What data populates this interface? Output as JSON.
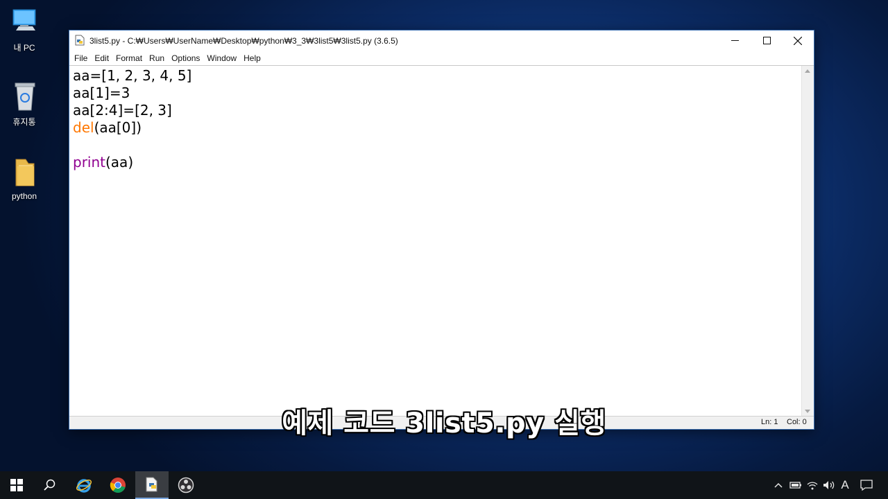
{
  "desktop": {
    "icons": [
      {
        "label": "내 PC",
        "icon": "this-pc-icon"
      },
      {
        "label": "휴지통",
        "icon": "recycle-bin-icon"
      },
      {
        "label": "python",
        "icon": "folder-icon"
      }
    ]
  },
  "window": {
    "title": "3list5.py - C:₩Users₩UserName₩Desktop₩python₩3_3₩3list5₩3list5.py (3.6.5)",
    "menu": [
      "File",
      "Edit",
      "Format",
      "Run",
      "Options",
      "Window",
      "Help"
    ],
    "code": {
      "line1": "aa=[1, 2, 3, 4, 5]",
      "line2": "aa[1]=3",
      "line3": "aa[2:4]=[2, 3]",
      "line4_keyword": "del",
      "line4_rest": "(aa[0])",
      "line6_keyword": "print",
      "line6_rest": "(aa)"
    },
    "status": {
      "line": "Ln: 1",
      "col": "Col: 0"
    },
    "colors": {
      "del_keyword": "#ff7700",
      "builtin": "#900090"
    }
  },
  "subtitle": "예제 코드 3list5.py 실행",
  "taskbar": {
    "apps": [
      "start-icon",
      "search-icon",
      "internet-explorer-icon",
      "chrome-icon",
      "python-idle-icon",
      "obs-icon"
    ],
    "tray": [
      "chevron-up-icon",
      "battery-icon",
      "wifi-icon",
      "volume-icon",
      "ime-indicator",
      "notification-icon"
    ],
    "ime": "A"
  }
}
